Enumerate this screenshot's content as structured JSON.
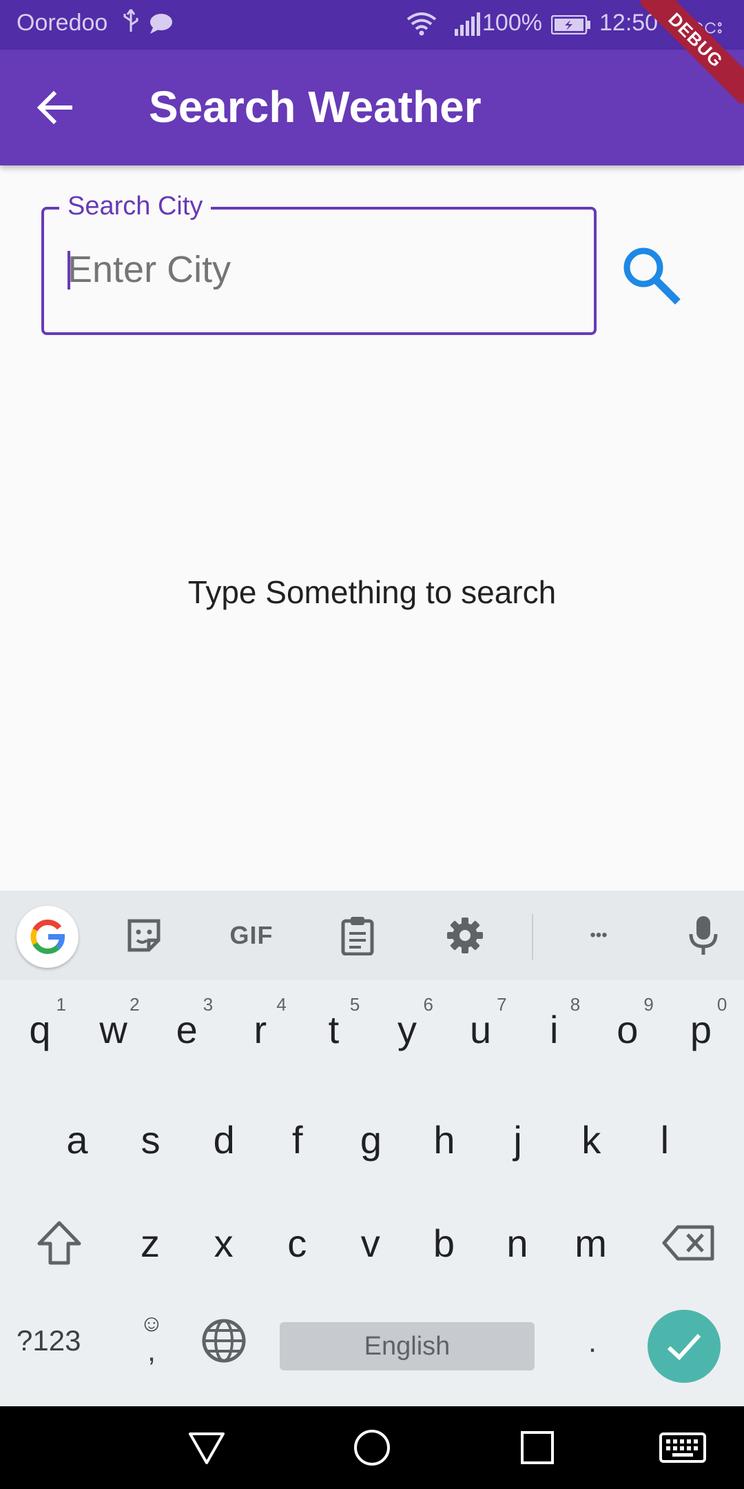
{
  "status": {
    "carrier": "Ooredoo",
    "battery": "100%",
    "time": "12:50",
    "extra": "ာငေး"
  },
  "debug_banner": "DEBUG",
  "appbar": {
    "title": "Search Weather"
  },
  "search": {
    "label": "Search City",
    "placeholder": "Enter City",
    "value": ""
  },
  "empty_message": "Type Something to search",
  "keyboard": {
    "toolbar": {
      "gif": "GIF",
      "more": "•••"
    },
    "row1": [
      {
        "k": "q",
        "h": "1"
      },
      {
        "k": "w",
        "h": "2"
      },
      {
        "k": "e",
        "h": "3"
      },
      {
        "k": "r",
        "h": "4"
      },
      {
        "k": "t",
        "h": "5"
      },
      {
        "k": "y",
        "h": "6"
      },
      {
        "k": "u",
        "h": "7"
      },
      {
        "k": "i",
        "h": "8"
      },
      {
        "k": "o",
        "h": "9"
      },
      {
        "k": "p",
        "h": "0"
      }
    ],
    "row2": [
      "a",
      "s",
      "d",
      "f",
      "g",
      "h",
      "j",
      "k",
      "l"
    ],
    "row3": [
      "z",
      "x",
      "c",
      "v",
      "b",
      "n",
      "m"
    ],
    "symbols": "?123",
    "emoji_comma_top": "☺",
    "emoji_comma_bottom": ",",
    "space": "English",
    "period": "."
  },
  "colors": {
    "statusbar": "#512da8",
    "appbar": "#673ab7",
    "search_icon": "#1e88e5",
    "enter_key": "#4db6ac",
    "debug_ribbon": "#a8213a"
  }
}
